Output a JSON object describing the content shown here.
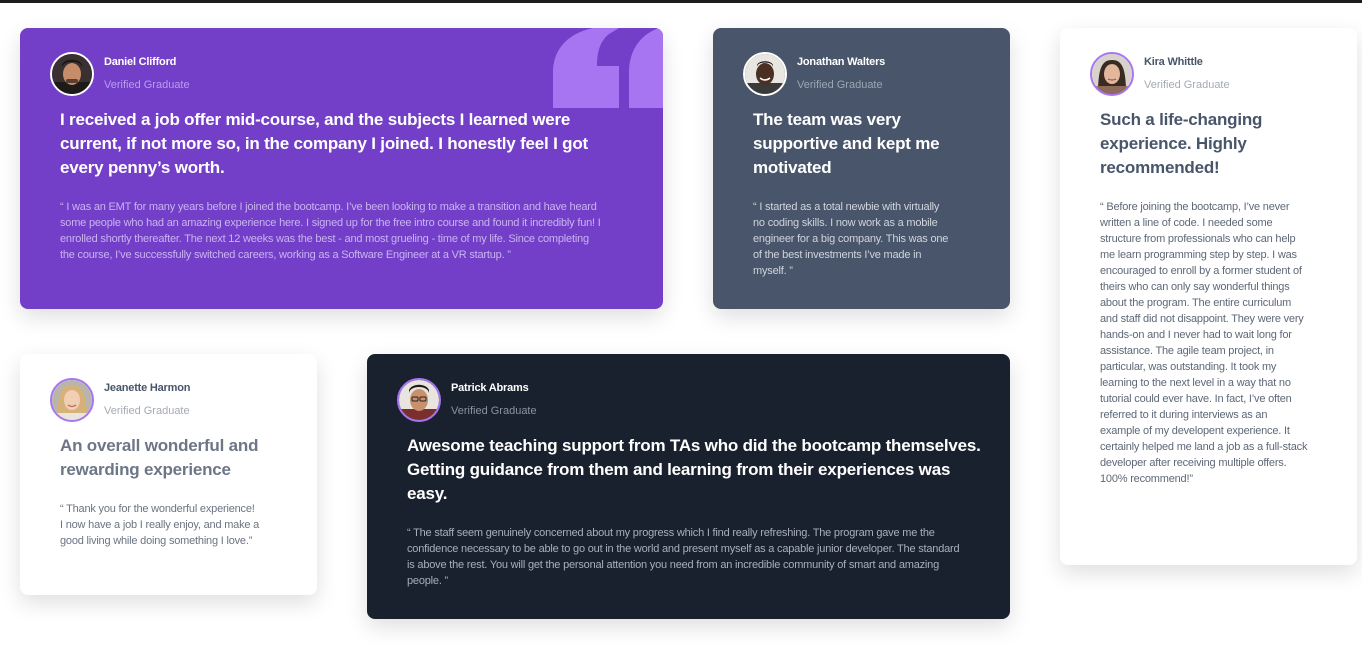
{
  "theme": {
    "purple": "#733fc8",
    "slate": "#48556a",
    "dark": "#19212e",
    "white": "#ffffff"
  },
  "testimonials": {
    "daniel": {
      "name": "Daniel Clifford",
      "role": "Verified Graduate",
      "avatar": "avatar-daniel",
      "headline": "I received a job offer mid-course, and the subjects I learned were current, if not more so,  in the company I joined. I honestly feel I got every penny’s worth.",
      "body": "“ I was an EMT for many years before I joined the bootcamp. I’ve been looking to make a  transition and have heard some people who had an amazing experience here. I signed up  for the free intro course and found it incredibly fun! I enrolled shortly thereafter.  The next 12 weeks was the best - and most grueling - time of my life. Since completing  the course, I’ve successfully switched careers, working as a Software Engineer at a VR startup. ”",
      "decoration": "quotation-mark-icon"
    },
    "jonathan": {
      "name": "Jonathan Walters",
      "role": "Verified Graduate",
      "avatar": "avatar-jonathan",
      "headline": "The team was very supportive and kept me motivated",
      "body": "“ I started as a total newbie with virtually no coding skills. I now work as a mobile engineer  for a big company. This was one of the best investments I’ve made in myself. ”"
    },
    "kira": {
      "name": "Kira Whittle",
      "role": "Verified Graduate",
      "avatar": "avatar-kira",
      "headline": "Such a life-changing experience. Highly recommended!",
      "body": "“ Before joining the bootcamp, I’ve never written a line of code. I needed some structure from  professionals who can help me learn programming step by step. I was encouraged to enroll by a former  student of theirs who can only say wonderful things about the program. The entire curriculum and staff  did not disappoint. They were very hands-on and I never had to wait long for assistance. The agile team  project, in particular, was outstanding. It took my learning to the next level in a way that no tutorial  could ever have. In fact, I’ve often referred to it during interviews as an example of my developent  experience. It certainly helped me land a job as a full-stack developer after receiving multiple offers.  100% recommend!”"
    },
    "jeanette": {
      "name": "Jeanette Harmon",
      "role": "Verified Graduate",
      "avatar": "avatar-jeanette",
      "headline": "An overall wonderful and rewarding experience",
      "body": "“ Thank you for the wonderful experience! I now have a job I really enjoy, and make a good living  while doing something I love.”"
    },
    "patrick": {
      "name": "Patrick Abrams",
      "role": "Verified Graduate",
      "avatar": "avatar-patrick",
      "headline": "Awesome teaching support from TAs who did the bootcamp themselves. Getting guidance from them and  learning from their experiences was easy.",
      "body": "“ The staff seem genuinely concerned about my progress which I find really refreshing. The program  gave me the confidence necessary to be able to go out in the world and present myself as a capable  junior developer. The standard is above the rest. You will get the personal attention you need from  an incredible community of smart and amazing people. ”"
    }
  }
}
